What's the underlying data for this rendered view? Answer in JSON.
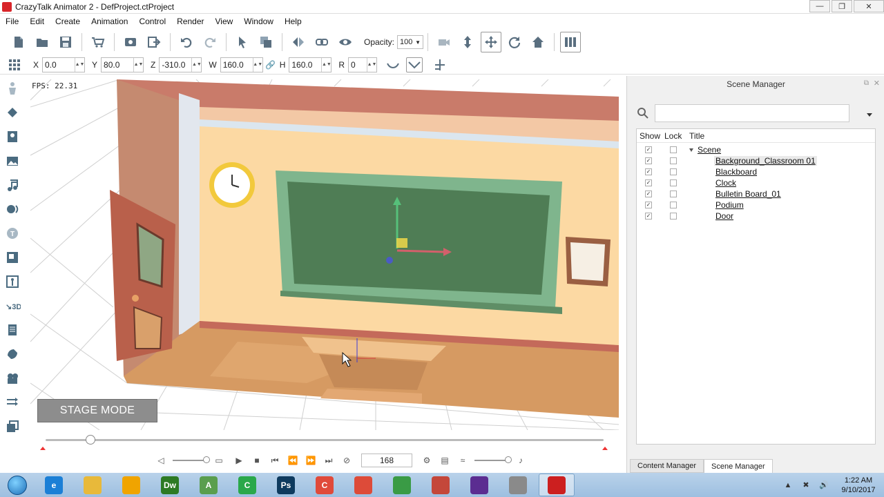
{
  "window": {
    "title": "CrazyTalk Animator 2  - DefProject.ctProject",
    "controls": [
      "—",
      "❐",
      "✕"
    ]
  },
  "menu": [
    "File",
    "Edit",
    "Create",
    "Animation",
    "Control",
    "Render",
    "View",
    "Window",
    "Help"
  ],
  "toolbar": {
    "opacity_label": "Opacity:",
    "opacity_value": "100"
  },
  "transform": {
    "x_label": "X",
    "x_value": "0.0",
    "y_label": "Y",
    "y_value": "80.0",
    "z_label": "Z",
    "z_value": "-310.0",
    "w_label": "W",
    "w_value": "160.0",
    "h_label": "H",
    "h_value": "160.0",
    "r_label": "R",
    "r_value": "0"
  },
  "left_tools": [
    "actor-icon",
    "prop-icon",
    "character-icon",
    "image-icon",
    "music-icon",
    "voice-icon",
    "text-icon",
    "scene-icon",
    "bone-icon",
    "3d-icon",
    "script-icon",
    "effect-icon",
    "camera-icon",
    "motion-icon",
    "layer-icon"
  ],
  "stage": {
    "fps": "FPS: 22.31",
    "mode_label": "STAGE MODE"
  },
  "playback": {
    "frame": "168",
    "timeline_progress": 0.08
  },
  "scene_manager": {
    "title": "Scene Manager",
    "search_placeholder": "",
    "columns": {
      "show": "Show",
      "lock": "Lock",
      "title": "Title"
    },
    "root": "Scene",
    "items": [
      {
        "title": "Background_Classroom 01",
        "show": true,
        "lock": false,
        "selected": true
      },
      {
        "title": "Blackboard",
        "show": true,
        "lock": false,
        "selected": false
      },
      {
        "title": "Clock",
        "show": true,
        "lock": false,
        "selected": false
      },
      {
        "title": "Bulletin Board_01",
        "show": true,
        "lock": false,
        "selected": false
      },
      {
        "title": "Podium",
        "show": true,
        "lock": false,
        "selected": false
      },
      {
        "title": "Door",
        "show": true,
        "lock": false,
        "selected": false
      }
    ],
    "tabs": [
      "Content Manager",
      "Scene Manager"
    ],
    "active_tab": "Scene Manager"
  },
  "taskbar": {
    "apps": [
      {
        "name": "ie-icon",
        "label": "e",
        "color": "#1b7fd6"
      },
      {
        "name": "explorer-icon",
        "label": "",
        "color": "#e8b93a"
      },
      {
        "name": "audition-icon",
        "label": "",
        "color": "#f0a400"
      },
      {
        "name": "dreamweaver-icon",
        "label": "Dw",
        "color": "#2d7a24"
      },
      {
        "name": "android-studio-icon",
        "label": "A",
        "color": "#5a9e4e"
      },
      {
        "name": "camtasia-icon",
        "label": "C",
        "color": "#2aa84a"
      },
      {
        "name": "photoshop-icon",
        "label": "Ps",
        "color": "#0e3a5e"
      },
      {
        "name": "crazytalk-taskbar-icon",
        "label": "C",
        "color": "#e04a3a"
      },
      {
        "name": "chrome-icon",
        "label": "",
        "color": "#dd4b39"
      },
      {
        "name": "chrome-alt-icon",
        "label": "",
        "color": "#3a9b45"
      },
      {
        "name": "snipping-icon",
        "label": "",
        "color": "#c4473a"
      },
      {
        "name": "visual-studio-icon",
        "label": "",
        "color": "#5b2d91"
      },
      {
        "name": "settings-app-icon",
        "label": "",
        "color": "#8a8a8a"
      },
      {
        "name": "crazytalk-active-icon",
        "label": "",
        "color": "#cc1f1f"
      }
    ],
    "time": "1:22 AM",
    "date": "9/10/2017"
  }
}
